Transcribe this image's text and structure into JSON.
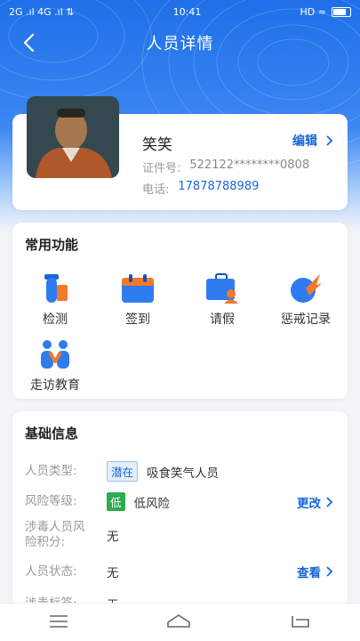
{
  "status_bar": {
    "left": "2G .ıl  4G .ıl  ⇅",
    "time": "10:41",
    "right": "HD ≈"
  },
  "header": {
    "title": "人员详情"
  },
  "profile": {
    "name": "笑笑",
    "edit_label": "编辑",
    "id_label": "证件号:",
    "id_value": "522122********0808",
    "phone_label": "电话:",
    "phone_value": "17878788989"
  },
  "functions": {
    "title": "常用功能",
    "items": [
      {
        "label": "检测",
        "icon": "test-tube-icon"
      },
      {
        "label": "签到",
        "icon": "calendar-icon"
      },
      {
        "label": "请假",
        "icon": "briefcase-icon"
      },
      {
        "label": "惩戒记录",
        "icon": "rocket-icon"
      },
      {
        "label": "走访教育",
        "icon": "visit-people-icon"
      }
    ]
  },
  "basic_info": {
    "title": "基础信息",
    "rows": [
      {
        "key": "人员类型:",
        "tag": "潜在",
        "value": "吸食笑气人员",
        "action": ""
      },
      {
        "key": "风险等级:",
        "tag": "低",
        "value": "低风险",
        "action": "更改"
      },
      {
        "key": "涉毒人员风险积分:",
        "tag": "",
        "value": "无",
        "action": ""
      },
      {
        "key": "人员状态:",
        "tag": "",
        "value": "无",
        "action": "查看"
      },
      {
        "key": "涉毒标签:",
        "tag": "",
        "value": "无",
        "action": ""
      }
    ]
  },
  "colors": {
    "primary": "#1a66d8",
    "header_blue": "#1f6fe8",
    "low_risk_green": "#2eaa4f"
  },
  "bottom_nav": [
    "menu-icon",
    "home-icon",
    "back-icon"
  ]
}
